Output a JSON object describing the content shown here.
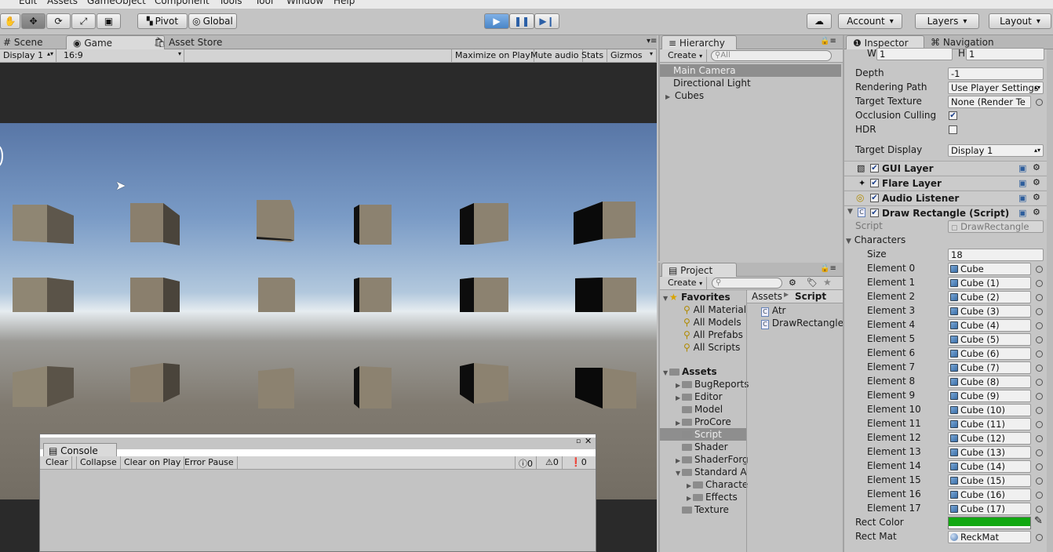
{
  "menu": [
    "Edit",
    "Assets",
    "GameObject",
    "Component",
    "Tools",
    "Tool",
    "Window",
    "Help"
  ],
  "toolbar": {
    "pivot_label": "Pivot",
    "global_label": "Global",
    "account_label": "Account",
    "layers_label": "Layers",
    "layout_label": "Layout"
  },
  "game_panel": {
    "tabs": [
      "Scene",
      "Game",
      "Asset Store"
    ],
    "display": "Display 1",
    "aspect": "16:9",
    "buttons": [
      "Maximize on Play",
      "Mute audio",
      "Stats",
      "Gizmos"
    ]
  },
  "console": {
    "title": "Console",
    "buttons": [
      "Clear",
      "Collapse",
      "Clear on Play",
      "Error Pause"
    ],
    "info_count": "0",
    "warning_count": "0",
    "error_count": "0"
  },
  "hierarchy": {
    "tab": "Hierarchy",
    "create": "Create",
    "search_placeholder": "All",
    "items": [
      "Main Camera",
      "Directional Light",
      "Cubes"
    ]
  },
  "project": {
    "tab": "Project",
    "create": "Create",
    "favorites_label": "Favorites",
    "favorites": [
      "All Material",
      "All Models",
      "All Prefabs",
      "All Scripts"
    ],
    "assets_label": "Assets",
    "folders": [
      "BugReports",
      "Editor",
      "Model",
      "ProCore",
      "Script",
      "Shader",
      "ShaderForg",
      "Standard A",
      "Characte",
      "Effects",
      "Texture"
    ],
    "breadcrumb_root": "Assets",
    "breadcrumb_current": "Script",
    "files": [
      "Atr",
      "DrawRectangle"
    ]
  },
  "inspector": {
    "tabs": [
      "Inspector",
      "Navigation"
    ],
    "w_label": "W",
    "w_value": "1",
    "h_label": "H",
    "h_value": "1",
    "depth_label": "Depth",
    "depth_value": "-1",
    "rendering_path_label": "Rendering Path",
    "rendering_path_value": "Use Player Settings",
    "target_texture_label": "Target Texture",
    "target_texture_value": "None (Render Te",
    "occlusion_label": "Occlusion Culling",
    "hdr_label": "HDR",
    "target_display_label": "Target Display",
    "target_display_value": "Display 1",
    "components": [
      "GUI Layer",
      "Flare Layer",
      "Audio Listener",
      "Draw Rectangle (Script)"
    ],
    "script_label": "Script",
    "script_value": "DrawRectangle",
    "characters_label": "Characters",
    "size_label": "Size",
    "size_value": "18",
    "elements": [
      {
        "label": "Element 0",
        "value": "Cube"
      },
      {
        "label": "Element 1",
        "value": "Cube (1)"
      },
      {
        "label": "Element 2",
        "value": "Cube (2)"
      },
      {
        "label": "Element 3",
        "value": "Cube (3)"
      },
      {
        "label": "Element 4",
        "value": "Cube (4)"
      },
      {
        "label": "Element 5",
        "value": "Cube (5)"
      },
      {
        "label": "Element 6",
        "value": "Cube (6)"
      },
      {
        "label": "Element 7",
        "value": "Cube (7)"
      },
      {
        "label": "Element 8",
        "value": "Cube (8)"
      },
      {
        "label": "Element 9",
        "value": "Cube (9)"
      },
      {
        "label": "Element 10",
        "value": "Cube (10)"
      },
      {
        "label": "Element 11",
        "value": "Cube (11)"
      },
      {
        "label": "Element 12",
        "value": "Cube (12)"
      },
      {
        "label": "Element 13",
        "value": "Cube (13)"
      },
      {
        "label": "Element 14",
        "value": "Cube (14)"
      },
      {
        "label": "Element 15",
        "value": "Cube (15)"
      },
      {
        "label": "Element 16",
        "value": "Cube (16)"
      },
      {
        "label": "Element 17",
        "value": "Cube (17)"
      }
    ],
    "rect_color_label": "Rect Color",
    "rect_color_value": "#11a811",
    "rect_mat_label": "Rect Mat",
    "rect_mat_value": "ReckMat"
  },
  "colors": {
    "play_active": "#4a90d9",
    "accent_blue": "#3b78c4"
  }
}
